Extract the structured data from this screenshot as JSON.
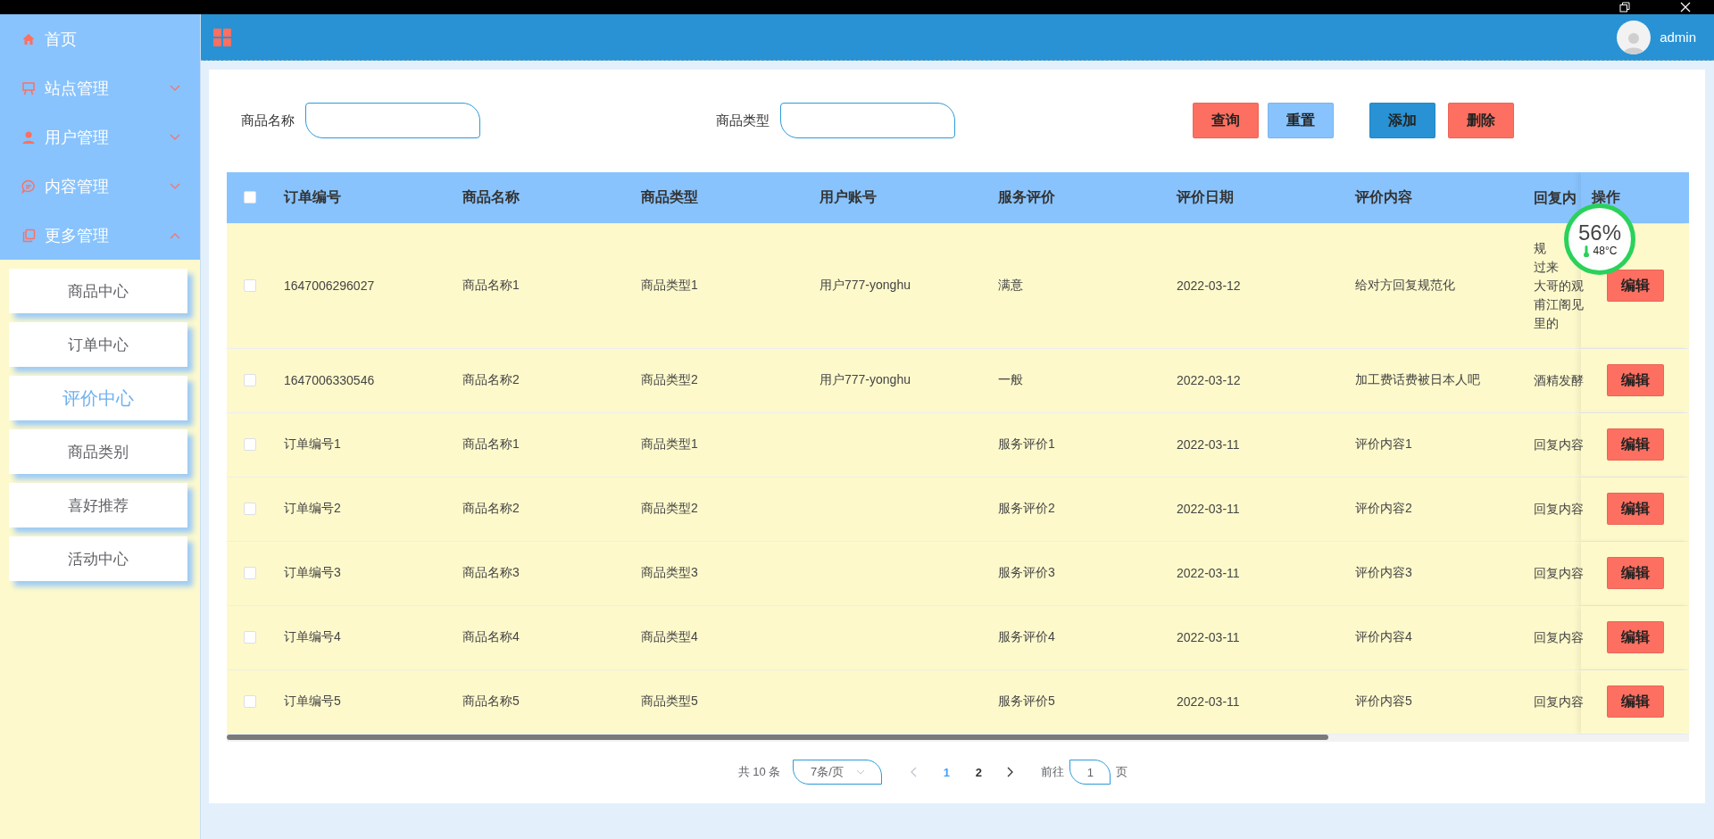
{
  "sidebar": {
    "menu": [
      {
        "label": "首页",
        "kind": "link"
      },
      {
        "label": "站点管理",
        "kind": "group",
        "expanded": false
      },
      {
        "label": "用户管理",
        "kind": "group",
        "expanded": false
      },
      {
        "label": "内容管理",
        "kind": "group",
        "expanded": false
      },
      {
        "label": "更多管理",
        "kind": "group",
        "expanded": true
      }
    ],
    "submenu": [
      {
        "label": "商品中心",
        "selected": false
      },
      {
        "label": "订单中心",
        "selected": false
      },
      {
        "label": "评价中心",
        "selected": true
      },
      {
        "label": "商品类别",
        "selected": false
      },
      {
        "label": "喜好推荐",
        "selected": false
      },
      {
        "label": "活动中心",
        "selected": false
      }
    ]
  },
  "header": {
    "user": "admin"
  },
  "filters": [
    {
      "label": "商品名称"
    },
    {
      "label": "商品类型"
    }
  ],
  "buttons": [
    {
      "label": "查询",
      "kind": "danger"
    },
    {
      "label": "重置",
      "kind": "secondary"
    },
    {
      "label": "添加",
      "kind": "primary"
    },
    {
      "label": "删除",
      "kind": "danger"
    }
  ],
  "table": {
    "select_all": {
      "checked": false
    },
    "columns": [
      "订单编号",
      "商品名称",
      "商品类型",
      "用户账号",
      "服务评价",
      "评价日期",
      "评价内容",
      "回复内",
      "操作"
    ],
    "rows": [
      {
        "checked": false,
        "cells": [
          "1647006296027",
          "商品名称1",
          "商品类型1",
          "用户777-yonghu",
          "满意",
          "2022-03-12",
          "给对方回复规范化"
        ],
        "reply": [
          "规",
          "过来",
          "大哥的观",
          "甫江阁见",
          "里的"
        ],
        "action": "编辑"
      },
      {
        "checked": false,
        "cells": [
          "1647006330546",
          "商品名称2",
          "商品类型2",
          "用户777-yonghu",
          "一般",
          "2022-03-12",
          "加工费话费被日本人吧"
        ],
        "reply": [
          "酒精发酵"
        ],
        "action": "编辑"
      },
      {
        "checked": false,
        "cells": [
          "订单编号1",
          "商品名称1",
          "商品类型1",
          "",
          "服务评价1",
          "2022-03-11",
          "评价内容1"
        ],
        "reply": [
          "回复内容"
        ],
        "action": "编辑"
      },
      {
        "checked": false,
        "cells": [
          "订单编号2",
          "商品名称2",
          "商品类型2",
          "",
          "服务评价2",
          "2022-03-11",
          "评价内容2"
        ],
        "reply": [
          "回复内容"
        ],
        "action": "编辑"
      },
      {
        "checked": false,
        "cells": [
          "订单编号3",
          "商品名称3",
          "商品类型3",
          "",
          "服务评价3",
          "2022-03-11",
          "评价内容3"
        ],
        "reply": [
          "回复内容"
        ],
        "action": "编辑"
      },
      {
        "checked": false,
        "cells": [
          "订单编号4",
          "商品名称4",
          "商品类型4",
          "",
          "服务评价4",
          "2022-03-11",
          "评价内容4"
        ],
        "reply": [
          "回复内容"
        ],
        "action": "编辑"
      },
      {
        "checked": false,
        "cells": [
          "订单编号5",
          "商品名称5",
          "商品类型5",
          "",
          "服务评价5",
          "2022-03-11",
          "评价内容5"
        ],
        "reply": [
          "回复内容"
        ],
        "action": "编辑"
      }
    ]
  },
  "pagination": {
    "total": "共 10 条",
    "page_size": "7条/页",
    "pages": [
      {
        "label": "1",
        "selected": true
      },
      {
        "label": "2",
        "selected": false
      }
    ],
    "goto_label": "前往",
    "goto_value": "1",
    "goto_suffix": "页"
  },
  "monitor": {
    "percent": "56%",
    "temperature": "48°C"
  }
}
